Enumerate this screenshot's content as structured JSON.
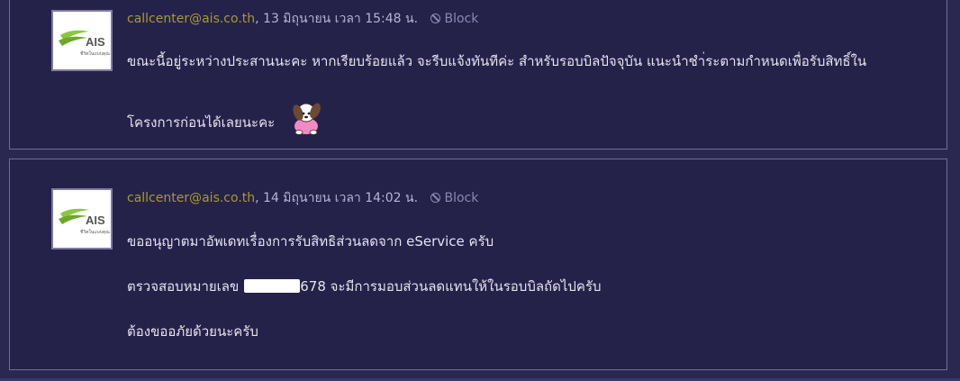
{
  "comments": [
    {
      "author_email": "callcenter@ais.co.th",
      "date": ", 13 มิถุนายน เวลา 15:48 น.",
      "block_label": "Block",
      "avatar_text": "AIS",
      "avatar_subtext": "ชีวิตในแบบคุณ",
      "lines": [
        "ขณะนี้อยู่ระหว่างประสานนะคะ  หากเรียบร้อยแล้ว จะรีบแจ้งทันทีค่ะ  สำหรับรอบบิลปัจจุบัน แนะนำชำ่ระตามกำหนดเพื่อรับสิทธิ์ใน",
        "โครงการก่อนได้เลยนะคะ"
      ],
      "sticker_icon": "puppy-sticker-icon"
    },
    {
      "author_email": "callcenter@ais.co.th",
      "date": ", 14 มิถุนายน เวลา 14:02 น.",
      "block_label": "Block",
      "avatar_text": "AIS",
      "avatar_subtext": "ชีวิตในแบบคุณ",
      "lines": [
        "ขออนุญาตมาอัพเดทเรื่องการรับสิทธิส่วนลดจาก eService ครับ",
        "ตรวจสอบหมายเลข",
        "678 จะมีการมอบส่วนลดแทนให้ในรอบบิลถัดไปครับ",
        "ต้องขออภัยด้วยนะครับ"
      ]
    }
  ],
  "colors": {
    "background": "#2a2850",
    "email": "#a89a2f",
    "text": "#e4e3f0",
    "muted": "#8a87b2",
    "ais_green": "#8cc63e"
  }
}
